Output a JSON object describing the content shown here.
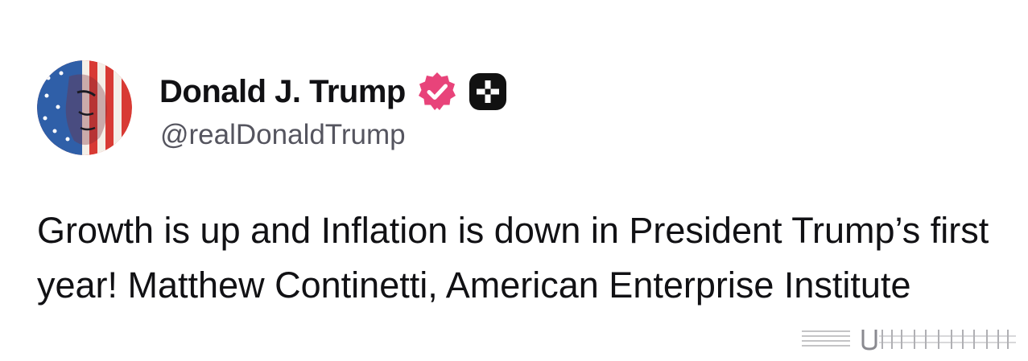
{
  "profile": {
    "display_name": "Donald J. Trump",
    "handle": "@realDonaldTrump",
    "verified_badge_color": "#e8437a",
    "plus_badge_color": "#111111"
  },
  "post": {
    "text": "Growth is up and Inflation is down in President Trump’s first year! Matthew Continetti, American Enterprise Institute"
  },
  "icons": {
    "avatar": "profile-avatar",
    "verified": "verified-badge-icon",
    "plus": "plus-badge-icon"
  }
}
